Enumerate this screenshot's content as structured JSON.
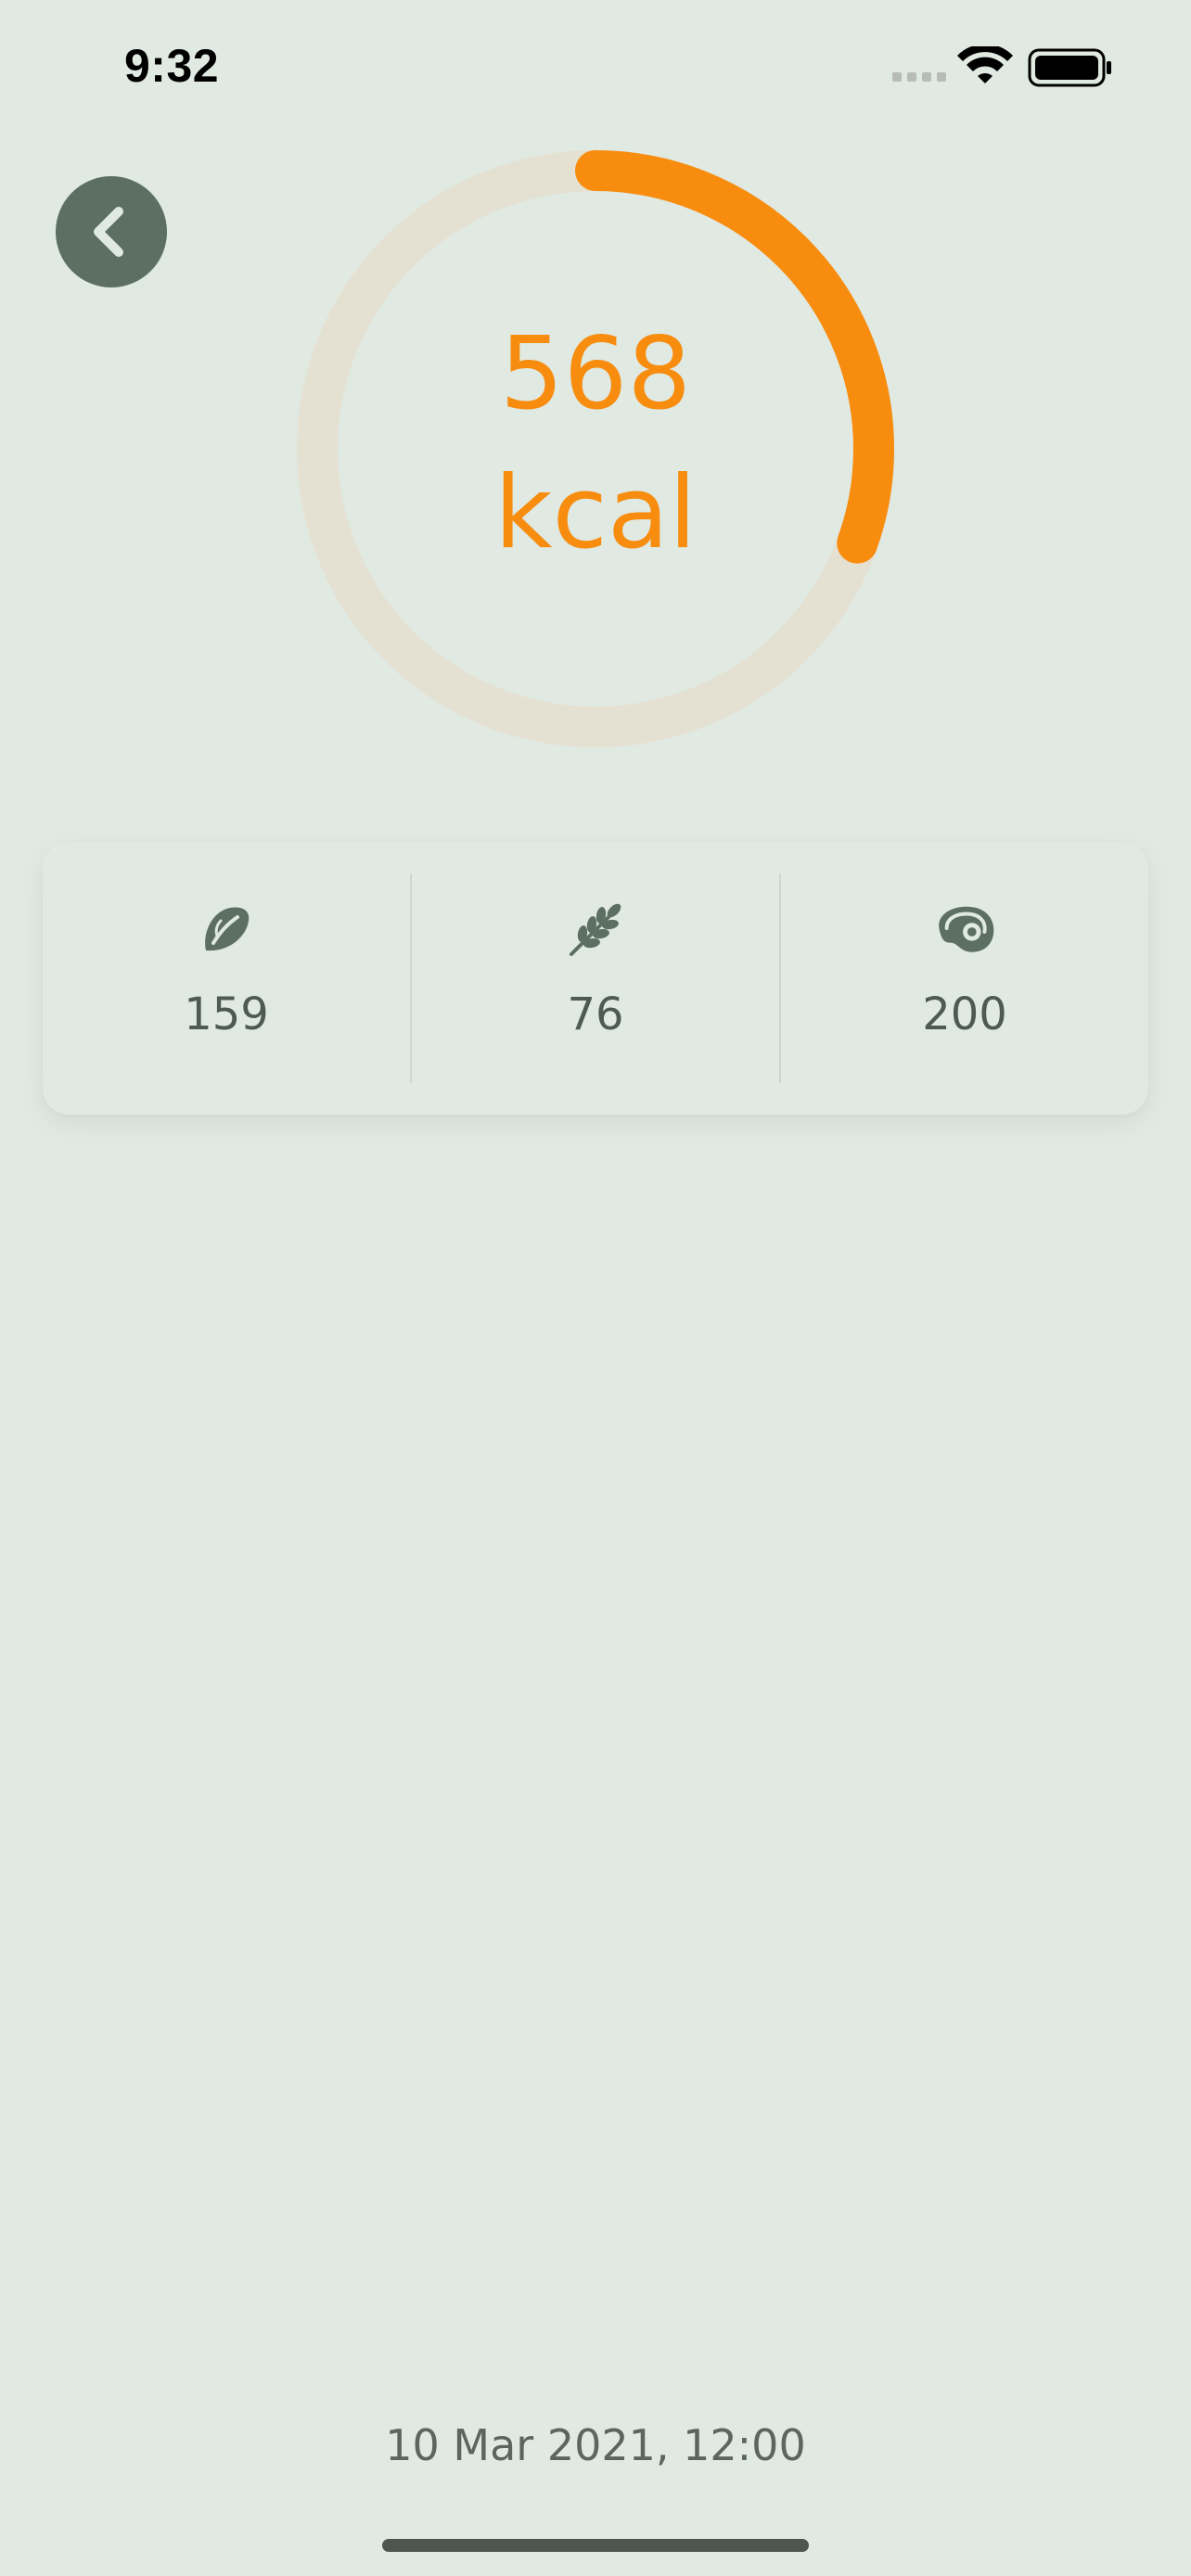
{
  "status_bar": {
    "time": "9:32"
  },
  "navigation": {
    "back_icon": "chevron-left-icon"
  },
  "calories": {
    "value": "568",
    "unit": "kcal",
    "progress_fraction": 0.305,
    "colors": {
      "progress": "#f78c0f",
      "track": "#e5e1d2"
    }
  },
  "macros": [
    {
      "name": "fat",
      "icon": "almond-icon",
      "value": "159"
    },
    {
      "name": "carbs",
      "icon": "wheat-icon",
      "value": "76"
    },
    {
      "name": "protein",
      "icon": "steak-icon",
      "value": "200"
    }
  ],
  "footer": {
    "date": "10 Mar 2021, 12:00"
  },
  "colors": {
    "background": "#e0e9e2",
    "accent": "#f78c0f",
    "icon": "#5c6f62"
  }
}
